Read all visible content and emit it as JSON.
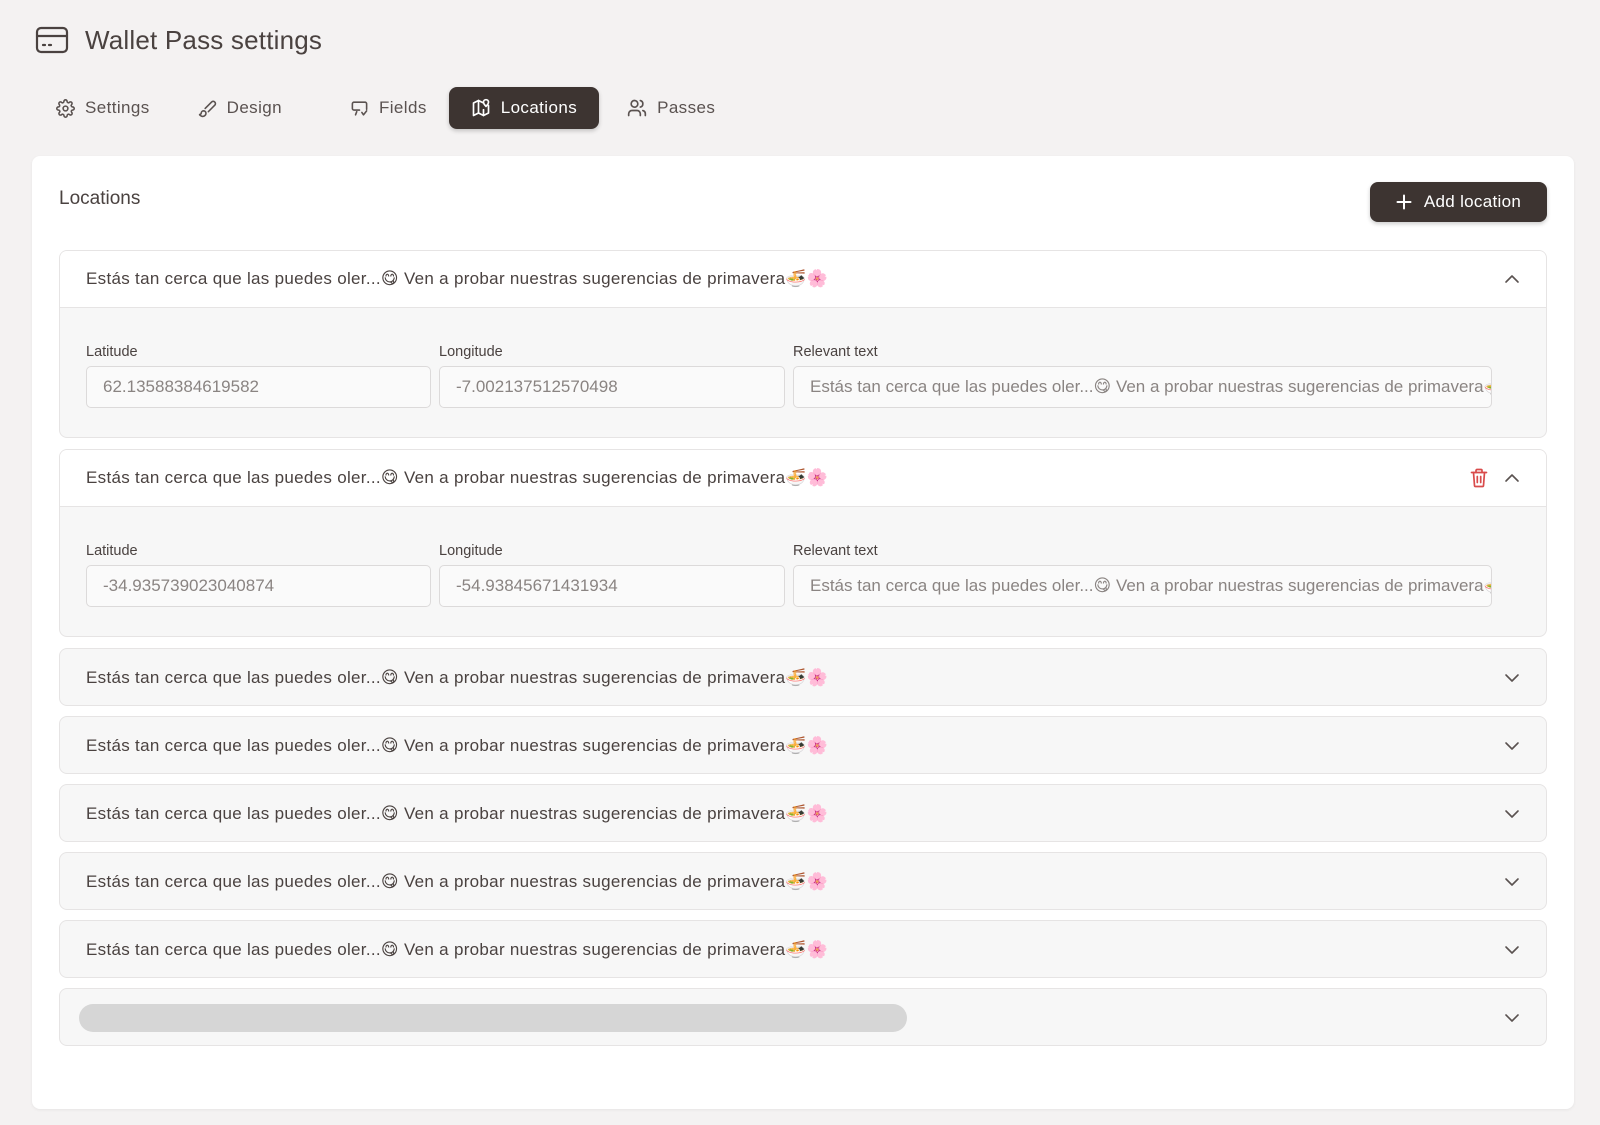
{
  "header": {
    "title": "Wallet Pass settings",
    "icon": "card-icon"
  },
  "tabs": [
    {
      "label": "Settings",
      "icon": "gear-icon",
      "active": false
    },
    {
      "label": "Design",
      "icon": "brush-icon",
      "active": false
    },
    {
      "label": "Fields",
      "icon": "fields-icon",
      "active": false
    },
    {
      "label": "Locations",
      "icon": "map-icon",
      "active": true
    },
    {
      "label": "Passes",
      "icon": "users-icon",
      "active": false
    }
  ],
  "card": {
    "title": "Locations",
    "add_button": "Add location"
  },
  "field_labels": {
    "latitude": "Latitude",
    "longitude": "Longitude",
    "relevant_text": "Relevant text"
  },
  "locations": [
    {
      "title": "Estás tan cerca que las puedes oler...😋 Ven a probar nuestras sugerencias de primavera🍜🌸",
      "expanded": true,
      "latitude": "62.13588384619582",
      "longitude": "-7.002137512570498",
      "relevant_text": "Estás tan cerca que las puedes oler...😋 Ven a probar nuestras sugerencias de primavera🍜🌸"
    },
    {
      "title": "Estás tan cerca que las puedes oler...😋 Ven a probar nuestras sugerencias de primavera🍜🌸",
      "expanded": true,
      "latitude": "-34.935739023040874",
      "longitude": "-54.93845671431934",
      "relevant_text": "Estás tan cerca que las puedes oler...😋 Ven a probar nuestras sugerencias de primavera🍜🌸"
    },
    {
      "title": "Estás tan cerca que las puedes oler...😋 Ven a probar nuestras sugerencias de primavera🍜🌸",
      "expanded": false
    },
    {
      "title": "Estás tan cerca que las puedes oler...😋 Ven a probar nuestras sugerencias de primavera🍜🌸",
      "expanded": false
    },
    {
      "title": "Estás tan cerca que las puedes oler...😋 Ven a probar nuestras sugerencias de primavera🍜🌸",
      "expanded": false
    },
    {
      "title": "Estás tan cerca que las puedes oler...😋 Ven a probar nuestras sugerencias de primavera🍜🌸",
      "expanded": false
    },
    {
      "title": "Estás tan cerca que las puedes oler...😋 Ven a probar nuestras sugerencias de primavera🍜🌸",
      "expanded": false
    }
  ],
  "colors": {
    "accent_dark": "#3d3431",
    "delete_red": "#d94b4b",
    "background": "#f4f2f2"
  }
}
